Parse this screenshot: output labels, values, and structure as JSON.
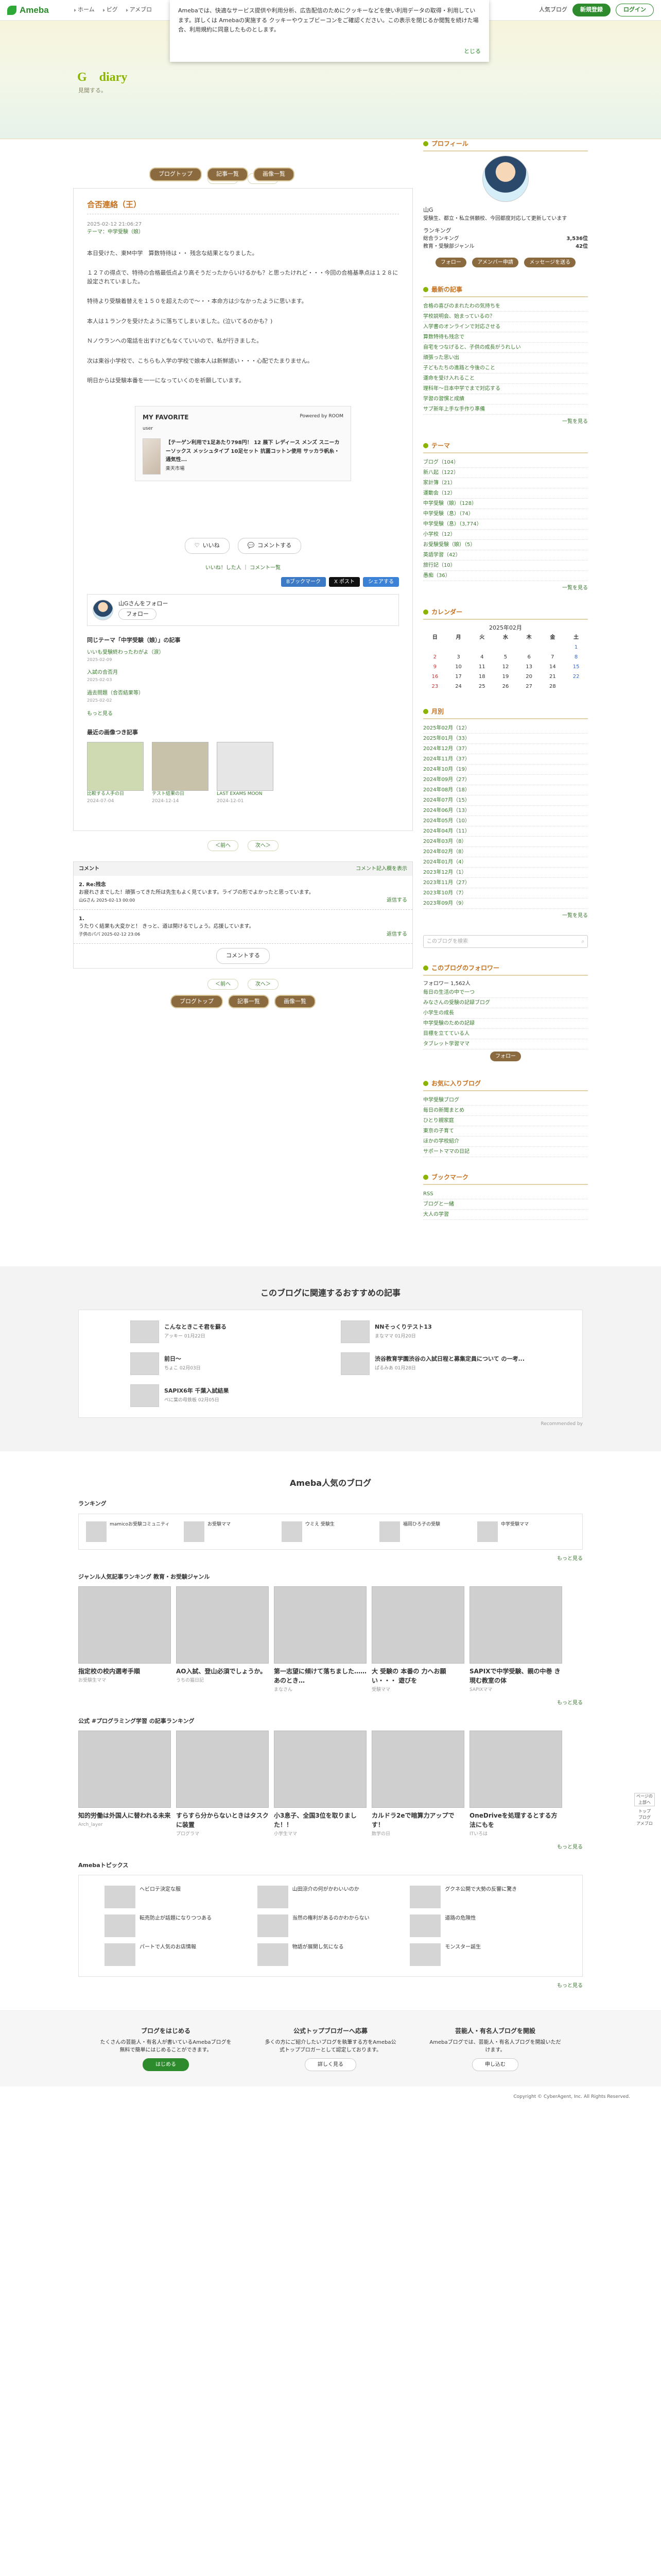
{
  "topbar": {
    "logo": "Ameba",
    "nav": [
      "ホーム",
      "ピグ",
      "アメブロ"
    ],
    "hot": "人気ブログ",
    "register": "新規登録",
    "login": "ログイン"
  },
  "cookie": {
    "text": "Amebaでは、快適なサービス提供や利用分析、広告配信のためにクッキーなどを使い利用データの取得・利用しています。詳しくは Amebaの実施する クッキーやウェブビーコンをご確認ください。この表示を閉じるか閲覧を続けた場合、利用規約に同意したものとします。",
    "close": "とじる"
  },
  "header": {
    "title": "G　diary",
    "desc": "見聞する。",
    "buttons": [
      "ブログトップ",
      "記事一覧",
      "画像一覧"
    ]
  },
  "pager": {
    "prev": "＜前へ",
    "next": "次へ＞",
    "list": "記事一覧"
  },
  "entry": {
    "title": "合否連絡（王）",
    "date": "2025-02-12 21:06:27",
    "theme": "テーマ：中学受験（娘）",
    "paragraphs": [
      "本日受けた、東M中学　算数特待は・・ 残念な結果となりました。",
      "１２７の得点で、特待の合格最低点より高そうだったからいけるかも？と思ったけれど・・・今回の合格基準点は１２８に設定されていました。",
      "特待より受験着替えを１５０を超えたので〜・・本命方は少なかったように思います。",
      "本人は１ランクを受けたように落ちてしまいました。(泣いてるのかも？)",
      "Ｎノウランへの電話を出すけどもなくていいので、私が行きました。",
      "次は東谷小学校で、こちらも入学の学校で娘本人は新鮮語い・・・心配でたまりません。",
      "明日からは受験本番を一一になっていくのを祈願しています。"
    ],
    "fav": {
      "title": "MY FAVORITE",
      "user": "user",
      "powered": "Powered by ROOM",
      "product": "【テーゲン利用で1足あたり798円！ 12 展下 レディース メンズ スニーカーソックス メッシュタイプ 10足セット 抗菌コットン使用 サッカラ帆糸・通気性...",
      "price": "楽天市場"
    },
    "like": "いいね",
    "comment": "コメントする",
    "rebloglink": "いいね！した人",
    "commentlink": "コメント一覧",
    "share": [
      "Bブックマーク",
      "X ポスト",
      "シェアする"
    ],
    "followtxt": "山Gさんをフォロー",
    "followbtn": "フォロー",
    "sametheme": "同じテーマ「中学受験（娘）」の記事",
    "samelist": [
      {
        "t": "いいも受験終わったわがよ（涙）",
        "d": "2025-02-09"
      },
      {
        "t": "入試の合否月",
        "d": "2025-02-03"
      },
      {
        "t": "過去問題（合否結果等）",
        "d": "2025-02-02"
      }
    ],
    "samemore": "もっと見る",
    "recentimg": "最近の画像つき記事",
    "thumbs": [
      {
        "t": "比較する人手の日",
        "d": "2024-07-04"
      },
      {
        "t": "テスト結果の日",
        "d": "2024-12-14"
      },
      {
        "t": "LAST EXAMS MOON",
        "d": "2024-12-01"
      }
    ]
  },
  "comments": {
    "label": "コメント",
    "all": "コメント記入欄を表示",
    "items": [
      {
        "n": "2. Re:残念",
        "body": "お疲れさまでした！頑張ってきた所は先生もよく見ています。ライブの形でよかったと思っています。",
        "who": "山Gさん 2025-02-13 00:00",
        "reply": "返信する"
      },
      {
        "n": "1.",
        "body": "うたりく結果も大変かと！ きっと、道は開けるでしょう。応援しています。",
        "who": "子供のパパ 2025-02-12 23:06",
        "reply": "返信する"
      }
    ],
    "add": "コメントする"
  },
  "side": {
    "profile": "プロフィール",
    "user": "山G",
    "bio": "受験生、都立・私立併願校、今回都度対応して更新しています",
    "rank": "ランキング",
    "rank_items": [
      [
        "総合ランキング",
        "3,536位"
      ],
      [
        "教育・受験部ジャンル",
        "42位"
      ]
    ],
    "login": "ログイン",
    "readers": "読者になる",
    "follow": "フォロー",
    "ameba": "アメンバー申請",
    "message": "メッセージを送る",
    "latest": "最新の記事",
    "latestlist": [
      "合格の喜びのまれたわの気持ちを",
      "学校説明会、始まっているの？",
      "入学書のオンラインで対応させる",
      "算数特待も残念で",
      "自宅をつなげると、子供の成長がうれしい",
      "頑張った思い出",
      "子どもたちの進路と今後のこと",
      "運命を受け入れること",
      "理科年〜日本中学でまで対応する",
      "学習の習慣と成績",
      "サブ新年上手な手作り準備"
    ],
    "more": "一覧を見る",
    "rss": "RSS",
    "theme": "テーマ",
    "themelist": [
      "ブログ（104）",
      "新八起（122）",
      "家計簿（21）",
      "運動会（12）",
      "中学受験（娘）（128）",
      "中学受験（息）（74）",
      "中学受験（息）（3,774）",
      "小学校（12）",
      "お受験受験（娘）（5）",
      "英語学習（42）",
      "旅行記（10）",
      "愚痴（36）"
    ],
    "calendar": "カレンダー",
    "month": "2025年02月",
    "days": [
      "日",
      "月",
      "火",
      "水",
      "木",
      "金",
      "土"
    ],
    "weeks": [
      [
        "",
        "",
        "",
        "",
        "",
        "",
        "1"
      ],
      [
        "2",
        "3",
        "4",
        "5",
        "6",
        "7",
        "8"
      ],
      [
        "9",
        "10",
        "11",
        "12",
        "13",
        "14",
        "15"
      ],
      [
        "16",
        "17",
        "18",
        "19",
        "20",
        "21",
        "22"
      ],
      [
        "23",
        "24",
        "25",
        "26",
        "27",
        "28",
        ""
      ]
    ],
    "archive": "月別",
    "archivelist": [
      "2025年02月（12）",
      "2025年01月（33）",
      "2024年12月（37）",
      "2024年11月（37）",
      "2024年10月（19）",
      "2024年09月（27）",
      "2024年08月（18）",
      "2024年07月（15）",
      "2024年06月（13）",
      "2024年05月（10）",
      "2024年04月（11）",
      "2024年03月（8）",
      "2024年02月（8）",
      "2024年01月（4）",
      "2023年12月（1）",
      "2023年11月（27）",
      "2023年10月（7）",
      "2023年09月（9）"
    ],
    "search": "このブログを検索",
    "searchbtn": "検索",
    "followers": "このブログのフォロワー",
    "followercount": "フォロワー 1,562人",
    "followerlist": [
      "毎日の生活の中で一つ",
      "みなさんの受験の記録ブログ",
      "小学生の成長",
      "中学受験のための記録",
      "目標を立てている人",
      "タブレット学習ママ"
    ],
    "follow2": "フォロー",
    "favs": "お気に入りブログ",
    "favlist": [
      "中学受験ブログ",
      "毎日の新聞まとめ",
      "ひとり親家庭",
      "東京の子育て",
      "ほかの学校紹介",
      "サポートママの日記"
    ],
    "bookmark": "ブックマーク",
    "bookmarklist": [
      "RSS",
      "ブログと一緒",
      "大人の学習"
    ]
  },
  "rec": {
    "title": "このブログに関連するおすすめの記事",
    "items": [
      {
        "t": "こんなときこそ君を蘇る",
        "s": "アッキー 01月22日"
      },
      {
        "t": "NNそっくりテスト13",
        "s": "まなママ 01月20日"
      },
      {
        "t": "前日〜",
        "s": "ちょこ 02月03日"
      },
      {
        "t": "渋谷教育学園渋谷の入試日程と募集定員について の一考...",
        "s": "ぱるみあ 01月28日"
      },
      {
        "t": "SAPIX6年 千葉入試結果",
        "s": "ペに葉の母鉄板 02月05日"
      }
    ],
    "powered": "Recommended by"
  },
  "popular": {
    "title": "Ameba人気のブログ",
    "ranking": "ランキング",
    "rankitems": [
      "mamicoお受験コミュニティ",
      "お受験ママ",
      "ウミえ 受験生",
      "福岡ひろ子の受験",
      "中学受験ママ"
    ],
    "genre": "ジャンル人気記事ランキング 教育・お受験ジャンル",
    "genrecards": [
      {
        "t": "指定校の校内選考手順",
        "s": "お受験生ママ"
      },
      {
        "t": "AO入試、登山必須でしょうか。",
        "s": "うちの猫日記"
      },
      {
        "t": "第一志望に傾けて落ちました……あのとき…",
        "s": "まなさん"
      },
      {
        "t": "大 受験の 本番の 力へお願い・・・ 遊びを",
        "s": "受験ママ"
      },
      {
        "t": "SAPIXで中学受験、親の中巻 き現む教室の体",
        "s": "SAPIXママ"
      }
    ],
    "tech": "公式 #プログラミング学習 の記事ランキング",
    "techcards": [
      {
        "t": "知的労働は外国人に替われる未来",
        "s": "Arch_layer"
      },
      {
        "t": "すらすら分からないときはタスクに装置",
        "s": "プログラマ"
      },
      {
        "t": "小3息子、全国3位を取りました！！",
        "s": "小学生ママ"
      },
      {
        "t": "カルドラ2eで暗算力アップです！",
        "s": "数学の日"
      },
      {
        "t": "OneDriveを処理するとする方法にもを",
        "s": "ITいろは"
      }
    ],
    "topicstitle": "Amebaトピックス",
    "topics": [
      "ヘビロテ決定な服",
      "山田涼介の何がかわいいのか",
      "グクネ公開で大勢の反響に驚き",
      "転売防止が話題になりつつある",
      "当然の権利があるのかわからない",
      "道路の危険性",
      "パートで人気のお店情報",
      "物語が展開し気になる",
      "モンスター誕生"
    ],
    "morelink": "もっと見る"
  },
  "footer": [
    {
      "h": "ブログをはじめる",
      "p": "たくさんの芸能人・有名人が書いているAmebaブログを無料で簡単にはじめることができます。",
      "b": "はじめる",
      "x": "公式トップブロガーへ応募"
    },
    {
      "h": "公式トップブロガーへ応募",
      "p": "多くの方にご紹介したいブログを執筆する方をAmeba公式トップブロガーとして認定しております。",
      "b": "詳しく見る",
      "x": ""
    },
    {
      "h": "芸能人・有名人ブログを開設",
      "p": "Amebaブログでは、芸能人・有名人ブログを開設いただけます。",
      "b": "申し込む",
      "x": ""
    }
  ],
  "copyright": "Copyright © CyberAgent, Inc. All Rights Reserved.",
  "fixed": [
    "ページの上部へ",
    "トップ",
    "ブログ",
    "アメブロ"
  ]
}
